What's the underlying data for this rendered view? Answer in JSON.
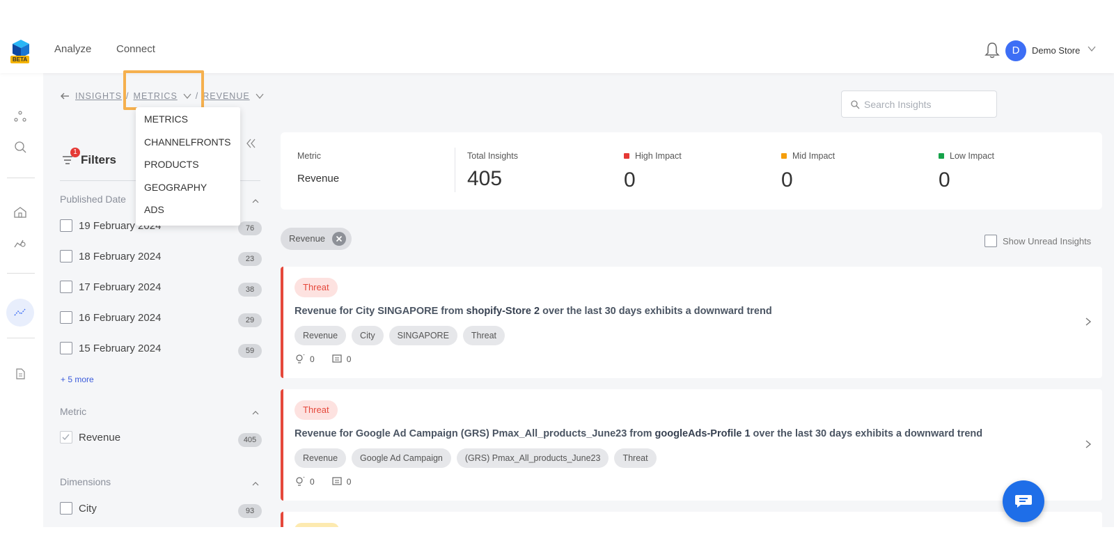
{
  "top_nav": {
    "logo_badge": "BETA",
    "links": [
      "Analyze",
      "Connect"
    ],
    "user_initial": "D",
    "user_name": "Demo Store"
  },
  "breadcrumb": {
    "root": "INSIGHTS",
    "level1": "METRICS",
    "level2": "REVENUE",
    "separator": "/"
  },
  "search": {
    "placeholder": "Search Insights"
  },
  "dropdown": {
    "items": [
      "METRICS",
      "CHANNELFRONTS",
      "PRODUCTS",
      "GEOGRAPHY",
      "ADS"
    ]
  },
  "filters": {
    "title": "Filters",
    "badge": "1",
    "published_date": {
      "title": "Published Date",
      "items": [
        {
          "label": "19 February 2024",
          "count": "76"
        },
        {
          "label": "18 February 2024",
          "count": "23"
        },
        {
          "label": "17 February 2024",
          "count": "38"
        },
        {
          "label": "16 February 2024",
          "count": "29"
        },
        {
          "label": "15 February 2024",
          "count": "59"
        }
      ],
      "more": "+ 5 more"
    },
    "metric": {
      "title": "Metric",
      "items": [
        {
          "label": "Revenue",
          "count": "405",
          "checked": true
        }
      ]
    },
    "dimensions": {
      "title": "Dimensions",
      "items": [
        {
          "label": "City",
          "count": "93"
        }
      ]
    }
  },
  "summary": {
    "metric_label": "Metric",
    "metric_value": "Revenue",
    "total_label": "Total Insights",
    "total_value": "405",
    "high_label": "High Impact",
    "high_value": "0",
    "mid_label": "Mid Impact",
    "mid_value": "0",
    "low_label": "Low Impact",
    "low_value": "0",
    "colors": {
      "high": "#e53935",
      "mid": "#f59e0b",
      "low": "#16a34a"
    }
  },
  "active_chip": "Revenue",
  "unread_toggle": "Show Unread Insights",
  "insights": [
    {
      "tag": "Threat",
      "title_prefix": "Revenue for City SINGAPORE from ",
      "title_highlight": "shopify-Store 2",
      "title_suffix": " over the last 30 days exhibits a downward trend",
      "tags": [
        "Revenue",
        "City",
        "SINGAPORE",
        "Threat"
      ],
      "ideas": "0",
      "comments": "0"
    },
    {
      "tag": "Threat",
      "title_prefix": "Revenue for Google Ad Campaign (GRS) Pmax_All_products_June23 from ",
      "title_highlight": "googleAds-Profile 1",
      "title_suffix": " over the last 30 days exhibits a downward trend",
      "tags": [
        "Revenue",
        "Google Ad Campaign",
        "(GRS) Pmax_All_products_June23",
        "Threat"
      ],
      "ideas": "0",
      "comments": "0"
    }
  ],
  "icons": [
    "logo-icon",
    "bell-icon",
    "chevron-down-icon",
    "back-arrow-icon",
    "search-icon",
    "filter-icon",
    "collapse-icon",
    "chevron-up-icon",
    "close-icon",
    "lightbulb-icon",
    "comment-icon",
    "chevron-right-icon",
    "chat-icon"
  ]
}
